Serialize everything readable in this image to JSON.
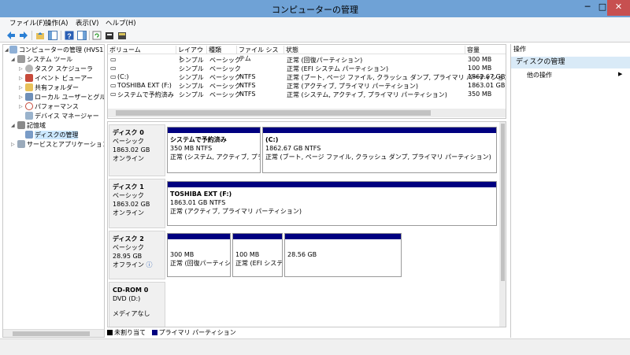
{
  "window": {
    "title": "コンピューターの管理",
    "min_label": "─",
    "max_label": "□",
    "close_label": "✕"
  },
  "menu": [
    "ファイル(F)",
    "操作(A)",
    "表示(V)",
    "ヘルプ(H)"
  ],
  "tree": {
    "root": "コンピューターの管理 (HVS12R2)",
    "system_tools": "システム ツール",
    "task_scheduler": "タスク スケジューラ",
    "event_viewer": "イベント ビューアー",
    "shared_folders": "共有フォルダー",
    "local_users": "ローカル ユーザーとグループ",
    "performance": "パフォーマンス",
    "device_manager": "デバイス マネージャー",
    "storage": "記憶域",
    "disk_management": "ディスクの管理",
    "services_apps": "サービスとアプリケーション"
  },
  "volume_list": {
    "headers": [
      "ボリューム",
      "レイアウト",
      "種類",
      "ファイル システム",
      "状態",
      "容量"
    ],
    "rows": [
      [
        "",
        "シンプル",
        "ベーシック",
        "",
        "正常 (回復パーティション)",
        "300 MB"
      ],
      [
        "",
        "シンプル",
        "ベーシック",
        "",
        "正常 (EFI システム パーティション)",
        "100 MB"
      ],
      [
        "(C:)",
        "シンプル",
        "ベーシック",
        "NTFS",
        "正常 (ブート, ページ ファイル, クラッシュ ダンプ, プライマリ パーティション)",
        "1862.67 GB"
      ],
      [
        "TOSHIBA EXT (F:)",
        "シンプル",
        "ベーシック",
        "NTFS",
        "正常 (アクティブ, プライマリ パーティション)",
        "1863.01 GB"
      ],
      [
        "システムで予約済み",
        "シンプル",
        "ベーシック",
        "NTFS",
        "正常 (システム, アクティブ, プライマリ パーティション)",
        "350 MB"
      ]
    ]
  },
  "disks": [
    {
      "name": "ディスク 0",
      "type": "ベーシック",
      "size": "1863.02 GB",
      "status": "オンライン",
      "partitions": [
        {
          "title": "システムで予約済み",
          "size": "350 MB NTFS",
          "state": "正常 (システム, アクティブ, プライマ"
        },
        {
          "title": "(C:)",
          "size": "1862.67 GB NTFS",
          "state": "正常 (ブート, ページ ファイル, クラッシュ ダンプ, プライマリ パーティション)"
        }
      ]
    },
    {
      "name": "ディスク 1",
      "type": "ベーシック",
      "size": "1863.02 GB",
      "status": "オンライン",
      "partitions": [
        {
          "title": "TOSHIBA EXT  (F:)",
          "size": "1863.01 GB NTFS",
          "state": "正常 (アクティブ, プライマリ パーティション)"
        }
      ]
    },
    {
      "name": "ディスク 2",
      "type": "ベーシック",
      "size": "28.95 GB",
      "status": "オフライン",
      "partitions": [
        {
          "title": "",
          "size": "300 MB",
          "state": "正常 (回復パーティショ"
        },
        {
          "title": "",
          "size": "100 MB",
          "state": "正常 (EFI システ"
        },
        {
          "title": "",
          "size": "28.56 GB",
          "state": ""
        }
      ]
    },
    {
      "name": "CD-ROM 0",
      "type": "DVD (D:)",
      "size": "",
      "status": "メディアなし",
      "partitions": []
    }
  ],
  "legend": {
    "unallocated": "未割り当て",
    "primary": "プライマリ パーティション"
  },
  "actions": {
    "header": "操作",
    "section": "ディスクの管理",
    "item": "他の操作"
  },
  "colors": {
    "titlebar": "#6fa2d6",
    "partition_bar": "#000080",
    "close_button": "#c75050",
    "selection": "#cce8ff",
    "actions_section": "#d9eaf7"
  }
}
